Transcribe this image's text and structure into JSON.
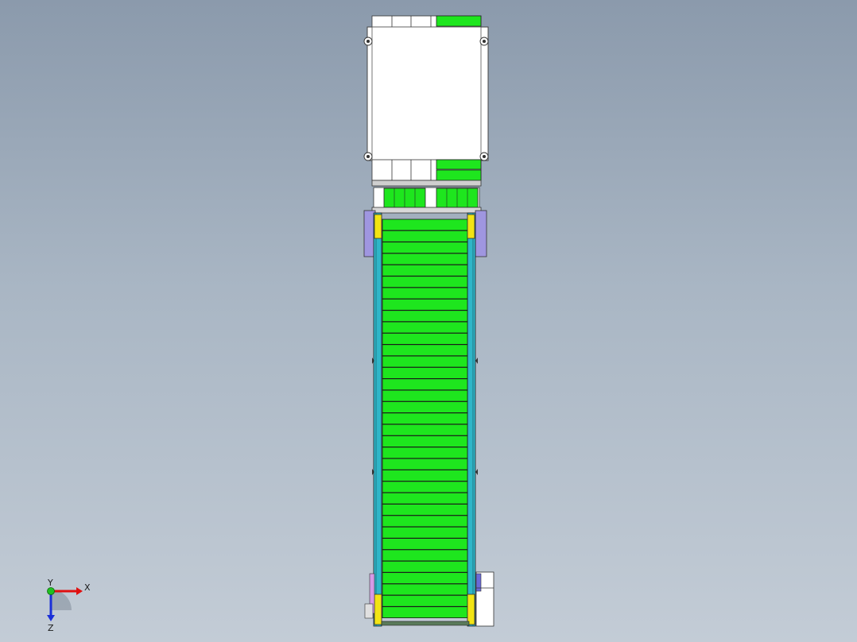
{
  "viewport": {
    "name": "cad-graphics-area",
    "background_top": "#8b9aac",
    "background_bottom": "#c3ccd6"
  },
  "model": {
    "name": "inclined-belt-conveyor",
    "slat_color": "#1ee61e",
    "frame_color": "#2fb6c8",
    "bracket_color": "#f2e414",
    "guard_color": "#9f96e0",
    "slat_count": 35
  },
  "triad": {
    "x_label": "X",
    "y_label": "Y",
    "z_label": "Z",
    "x_color": "#e01010",
    "y_color": "#20c020",
    "z_color": "#1a2fd8"
  }
}
